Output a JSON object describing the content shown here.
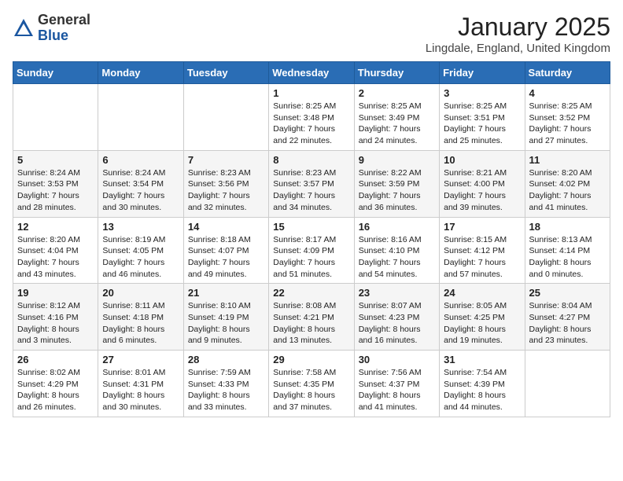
{
  "header": {
    "logo_general": "General",
    "logo_blue": "Blue",
    "month_title": "January 2025",
    "location": "Lingdale, England, United Kingdom"
  },
  "weekdays": [
    "Sunday",
    "Monday",
    "Tuesday",
    "Wednesday",
    "Thursday",
    "Friday",
    "Saturday"
  ],
  "weeks": [
    [
      {
        "day": "",
        "info": ""
      },
      {
        "day": "",
        "info": ""
      },
      {
        "day": "",
        "info": ""
      },
      {
        "day": "1",
        "info": "Sunrise: 8:25 AM\nSunset: 3:48 PM\nDaylight: 7 hours\nand 22 minutes."
      },
      {
        "day": "2",
        "info": "Sunrise: 8:25 AM\nSunset: 3:49 PM\nDaylight: 7 hours\nand 24 minutes."
      },
      {
        "day": "3",
        "info": "Sunrise: 8:25 AM\nSunset: 3:51 PM\nDaylight: 7 hours\nand 25 minutes."
      },
      {
        "day": "4",
        "info": "Sunrise: 8:25 AM\nSunset: 3:52 PM\nDaylight: 7 hours\nand 27 minutes."
      }
    ],
    [
      {
        "day": "5",
        "info": "Sunrise: 8:24 AM\nSunset: 3:53 PM\nDaylight: 7 hours\nand 28 minutes."
      },
      {
        "day": "6",
        "info": "Sunrise: 8:24 AM\nSunset: 3:54 PM\nDaylight: 7 hours\nand 30 minutes."
      },
      {
        "day": "7",
        "info": "Sunrise: 8:23 AM\nSunset: 3:56 PM\nDaylight: 7 hours\nand 32 minutes."
      },
      {
        "day": "8",
        "info": "Sunrise: 8:23 AM\nSunset: 3:57 PM\nDaylight: 7 hours\nand 34 minutes."
      },
      {
        "day": "9",
        "info": "Sunrise: 8:22 AM\nSunset: 3:59 PM\nDaylight: 7 hours\nand 36 minutes."
      },
      {
        "day": "10",
        "info": "Sunrise: 8:21 AM\nSunset: 4:00 PM\nDaylight: 7 hours\nand 39 minutes."
      },
      {
        "day": "11",
        "info": "Sunrise: 8:20 AM\nSunset: 4:02 PM\nDaylight: 7 hours\nand 41 minutes."
      }
    ],
    [
      {
        "day": "12",
        "info": "Sunrise: 8:20 AM\nSunset: 4:04 PM\nDaylight: 7 hours\nand 43 minutes."
      },
      {
        "day": "13",
        "info": "Sunrise: 8:19 AM\nSunset: 4:05 PM\nDaylight: 7 hours\nand 46 minutes."
      },
      {
        "day": "14",
        "info": "Sunrise: 8:18 AM\nSunset: 4:07 PM\nDaylight: 7 hours\nand 49 minutes."
      },
      {
        "day": "15",
        "info": "Sunrise: 8:17 AM\nSunset: 4:09 PM\nDaylight: 7 hours\nand 51 minutes."
      },
      {
        "day": "16",
        "info": "Sunrise: 8:16 AM\nSunset: 4:10 PM\nDaylight: 7 hours\nand 54 minutes."
      },
      {
        "day": "17",
        "info": "Sunrise: 8:15 AM\nSunset: 4:12 PM\nDaylight: 7 hours\nand 57 minutes."
      },
      {
        "day": "18",
        "info": "Sunrise: 8:13 AM\nSunset: 4:14 PM\nDaylight: 8 hours\nand 0 minutes."
      }
    ],
    [
      {
        "day": "19",
        "info": "Sunrise: 8:12 AM\nSunset: 4:16 PM\nDaylight: 8 hours\nand 3 minutes."
      },
      {
        "day": "20",
        "info": "Sunrise: 8:11 AM\nSunset: 4:18 PM\nDaylight: 8 hours\nand 6 minutes."
      },
      {
        "day": "21",
        "info": "Sunrise: 8:10 AM\nSunset: 4:19 PM\nDaylight: 8 hours\nand 9 minutes."
      },
      {
        "day": "22",
        "info": "Sunrise: 8:08 AM\nSunset: 4:21 PM\nDaylight: 8 hours\nand 13 minutes."
      },
      {
        "day": "23",
        "info": "Sunrise: 8:07 AM\nSunset: 4:23 PM\nDaylight: 8 hours\nand 16 minutes."
      },
      {
        "day": "24",
        "info": "Sunrise: 8:05 AM\nSunset: 4:25 PM\nDaylight: 8 hours\nand 19 minutes."
      },
      {
        "day": "25",
        "info": "Sunrise: 8:04 AM\nSunset: 4:27 PM\nDaylight: 8 hours\nand 23 minutes."
      }
    ],
    [
      {
        "day": "26",
        "info": "Sunrise: 8:02 AM\nSunset: 4:29 PM\nDaylight: 8 hours\nand 26 minutes."
      },
      {
        "day": "27",
        "info": "Sunrise: 8:01 AM\nSunset: 4:31 PM\nDaylight: 8 hours\nand 30 minutes."
      },
      {
        "day": "28",
        "info": "Sunrise: 7:59 AM\nSunset: 4:33 PM\nDaylight: 8 hours\nand 33 minutes."
      },
      {
        "day": "29",
        "info": "Sunrise: 7:58 AM\nSunset: 4:35 PM\nDaylight: 8 hours\nand 37 minutes."
      },
      {
        "day": "30",
        "info": "Sunrise: 7:56 AM\nSunset: 4:37 PM\nDaylight: 8 hours\nand 41 minutes."
      },
      {
        "day": "31",
        "info": "Sunrise: 7:54 AM\nSunset: 4:39 PM\nDaylight: 8 hours\nand 44 minutes."
      },
      {
        "day": "",
        "info": ""
      }
    ]
  ]
}
